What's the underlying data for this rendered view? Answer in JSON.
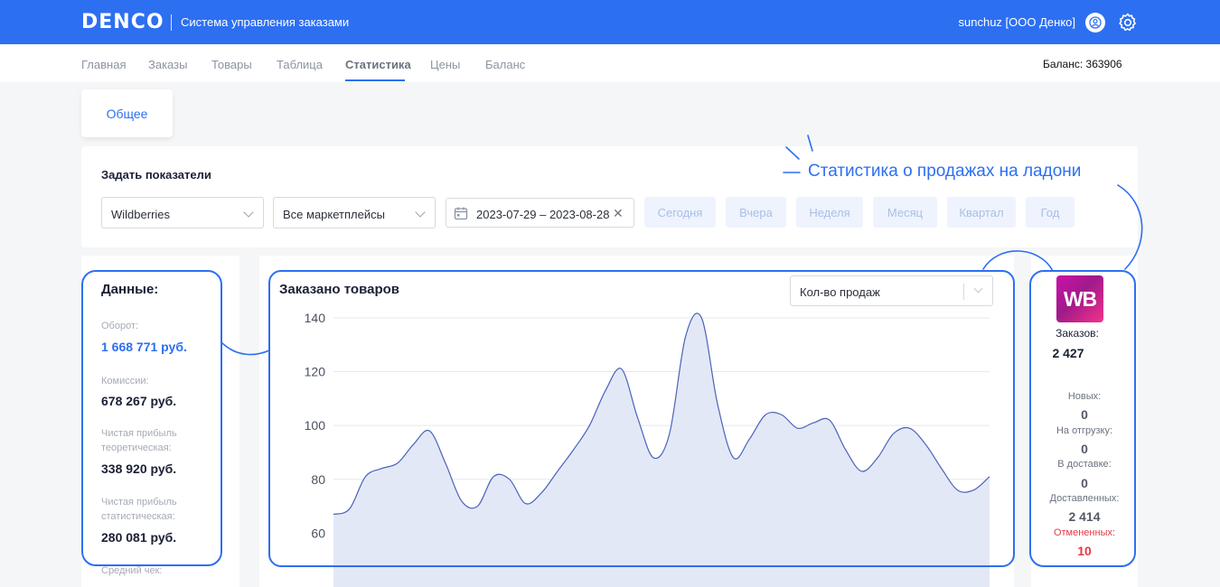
{
  "header": {
    "logo": "DENCO",
    "app_title": "Система управления заказами",
    "user": "sunchuz [ООО Денко]",
    "brand_color": "#2d6ff1"
  },
  "nav": {
    "items": [
      "Главная",
      "Заказы",
      "Товары",
      "Таблица",
      "Статистика",
      "Цены",
      "Баланс"
    ],
    "active": "Статистика",
    "balance": "Баланс: 363906"
  },
  "tabs": {
    "general": "Общее"
  },
  "filters": {
    "title": "Задать показатели",
    "marketplace": "Wildberries",
    "scope": "Все маркетплейсы",
    "date_range": "2023-07-29 – 2023-08-28",
    "periods": [
      "Сегодня",
      "Вчера",
      "Неделя",
      "Месяц",
      "Квартал",
      "Год"
    ]
  },
  "slogan": "Статистика о продажах на ладони",
  "data_panel": {
    "title": "Данные:",
    "turnover_label": "Оборот:",
    "turnover": "1 668 771 руб.",
    "commission_label": "Комиссии:",
    "commission": "678 267 руб.",
    "profit_theory_label_1": "Чистая прибыль",
    "profit_theory_label_2": "теоретическая:",
    "profit_theory": "338 920 руб.",
    "profit_stat_label_1": "Чистая прибыль",
    "profit_stat_label_2": "статистическая:",
    "profit_stat": "280 081 руб.",
    "avg_check_label": "Средний чек:"
  },
  "chart_panel": {
    "title": "Заказано товаров",
    "metric": "Кол-во продаж"
  },
  "chart_data": {
    "type": "area",
    "title": "Заказано товаров",
    "xlabel": "",
    "ylabel": "",
    "yticks": [
      60,
      80,
      100,
      120,
      140
    ],
    "ylim": [
      40,
      143
    ],
    "grid": true,
    "values": [
      67,
      69,
      81,
      84,
      86,
      93,
      98,
      86,
      72,
      70,
      81,
      80,
      71,
      75,
      83,
      91,
      100,
      113,
      121,
      103,
      88,
      97,
      133,
      140,
      108,
      88,
      95,
      104,
      104,
      99,
      101,
      102,
      91,
      83,
      88,
      97,
      99,
      93,
      84,
      76,
      76,
      81
    ],
    "line_color": "#4a63b8",
    "fill_color": "#e3e8f6"
  },
  "wb_panel": {
    "logo": "WB",
    "orders_label": "Заказов:",
    "orders": "2 427",
    "new_label": "Новых:",
    "new": "0",
    "to_ship_label": "На отгрузку:",
    "to_ship": "0",
    "in_delivery_label": "В доставке:",
    "in_delivery": "0",
    "delivered_label": "Доставленных:",
    "delivered": "2 414",
    "cancelled_label": "Отмененных:",
    "cancelled": "10",
    "cancelled_color": "#e53945"
  }
}
